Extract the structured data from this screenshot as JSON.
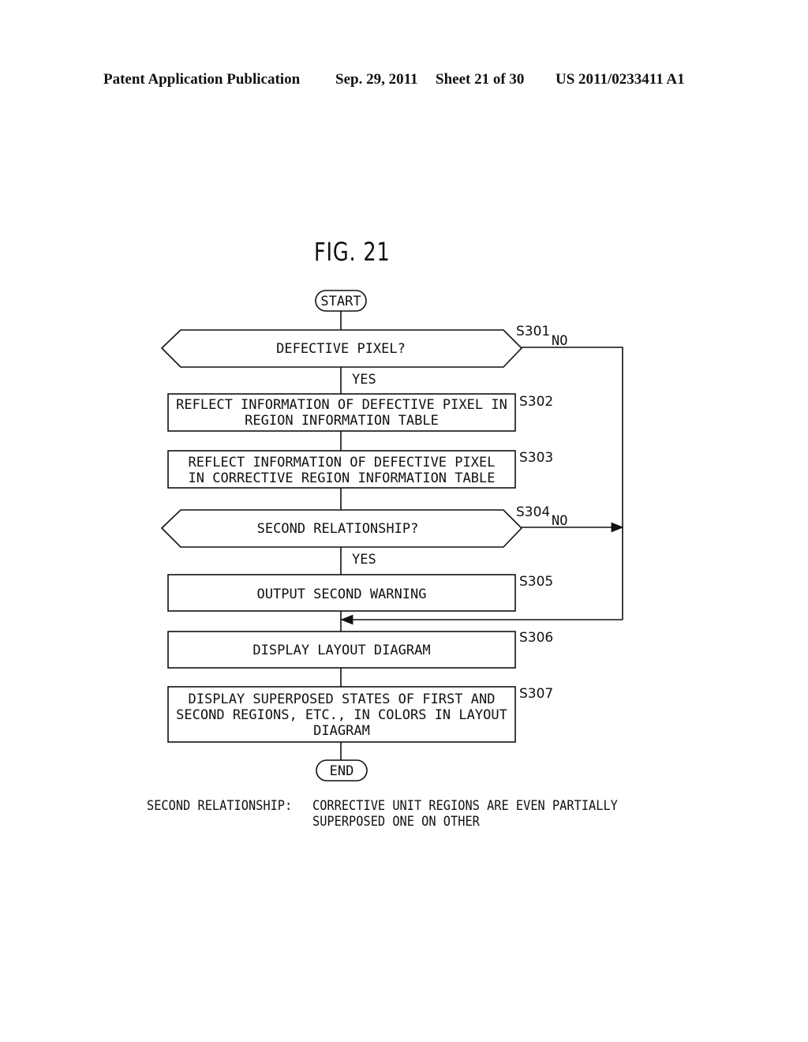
{
  "header": {
    "publication": "Patent Application Publication",
    "date": "Sep. 29, 2011",
    "sheet": "Sheet 21 of 30",
    "number": "US 2011/0233411 A1"
  },
  "figure_title": "FIG. 21",
  "flow": {
    "start": "START",
    "end": "END",
    "s301": {
      "id": "S301",
      "text": "DEFECTIVE PIXEL?",
      "yes": "YES",
      "no": "NO"
    },
    "s302": {
      "id": "S302",
      "lines": [
        "REFLECT INFORMATION OF DEFECTIVE PIXEL IN",
        "REGION INFORMATION TABLE"
      ]
    },
    "s303": {
      "id": "S303",
      "lines": [
        "REFLECT INFORMATION OF DEFECTIVE PIXEL",
        "IN CORRECTIVE REGION INFORMATION TABLE"
      ]
    },
    "s304": {
      "id": "S304",
      "text": "SECOND RELATIONSHIP?",
      "yes": "YES",
      "no": "NO"
    },
    "s305": {
      "id": "S305",
      "text": "OUTPUT SECOND WARNING"
    },
    "s306": {
      "id": "S306",
      "text": "DISPLAY LAYOUT DIAGRAM"
    },
    "s307": {
      "id": "S307",
      "lines": [
        "DISPLAY SUPERPOSED STATES OF FIRST AND",
        "SECOND REGIONS, ETC.,  IN COLORS IN LAYOUT",
        "DIAGRAM"
      ]
    }
  },
  "footnote": {
    "term": "SECOND RELATIONSHIP:",
    "line1": "CORRECTIVE UNIT REGIONS ARE EVEN PARTIALLY",
    "line2": "SUPERPOSED ONE ON OTHER"
  }
}
